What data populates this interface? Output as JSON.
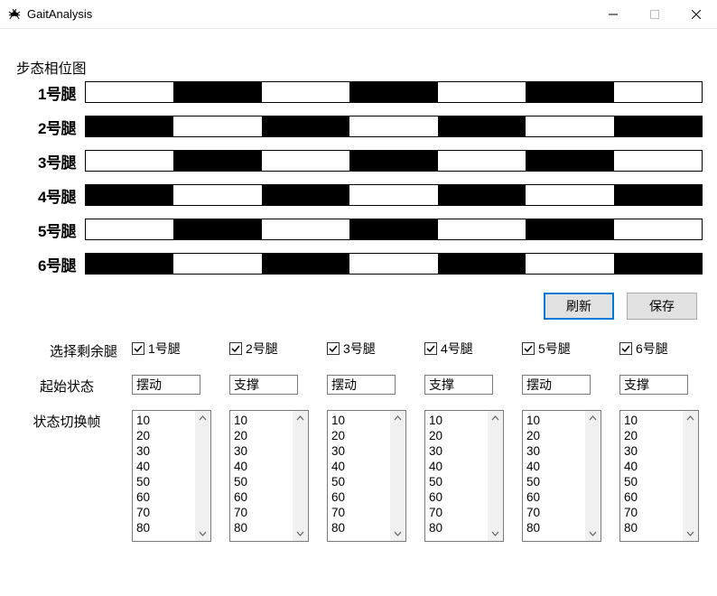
{
  "window": {
    "title": "GaitAnalysis"
  },
  "section": {
    "phase_chart_title": "步态相位图"
  },
  "legs": [
    {
      "name": "1号腿",
      "pattern": [
        0,
        1,
        0,
        1,
        0,
        1,
        0
      ]
    },
    {
      "name": "2号腿",
      "pattern": [
        1,
        0,
        1,
        0,
        1,
        0,
        1
      ]
    },
    {
      "name": "3号腿",
      "pattern": [
        0,
        1,
        0,
        1,
        0,
        1,
        0
      ]
    },
    {
      "name": "4号腿",
      "pattern": [
        1,
        0,
        1,
        0,
        1,
        0,
        1
      ]
    },
    {
      "name": "5号腿",
      "pattern": [
        0,
        1,
        0,
        1,
        0,
        1,
        0
      ]
    },
    {
      "name": "6号腿",
      "pattern": [
        1,
        0,
        1,
        0,
        1,
        0,
        1
      ]
    }
  ],
  "buttons": {
    "refresh": "刷新",
    "save": "保存"
  },
  "labels": {
    "select_remaining_legs": "选择剩余腿",
    "initial_state": "起始状态",
    "state_switch_frame": "状态切换帧"
  },
  "leg_checks": [
    {
      "label": "1号腿",
      "checked": true
    },
    {
      "label": "2号腿",
      "checked": true
    },
    {
      "label": "3号腿",
      "checked": true
    },
    {
      "label": "4号腿",
      "checked": true
    },
    {
      "label": "5号腿",
      "checked": true
    },
    {
      "label": "6号腿",
      "checked": true
    }
  ],
  "initial_states": [
    "摆动",
    "支撑",
    "摆动",
    "支撑",
    "摆动",
    "支撑"
  ],
  "frame_lists": [
    [
      "10",
      "20",
      "30",
      "40",
      "50",
      "60",
      "70",
      "80"
    ],
    [
      "10",
      "20",
      "30",
      "40",
      "50",
      "60",
      "70",
      "80"
    ],
    [
      "10",
      "20",
      "30",
      "40",
      "50",
      "60",
      "70",
      "80"
    ],
    [
      "10",
      "20",
      "30",
      "40",
      "50",
      "60",
      "70",
      "80"
    ],
    [
      "10",
      "20",
      "30",
      "40",
      "50",
      "60",
      "70",
      "80"
    ],
    [
      "10",
      "20",
      "30",
      "40",
      "50",
      "60",
      "70",
      "80"
    ]
  ]
}
